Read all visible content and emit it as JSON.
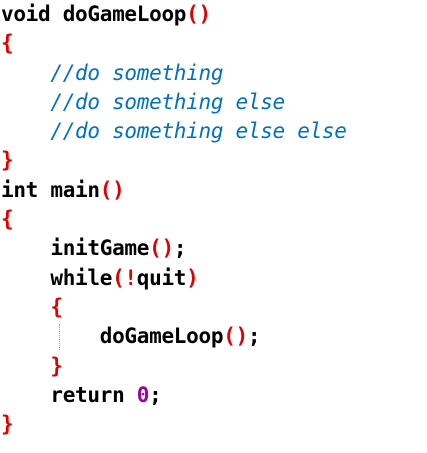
{
  "editor": {
    "lines": [
      [
        {
          "t": "void",
          "c": "kw"
        },
        {
          "t": " doGameLoop",
          "c": "ident"
        },
        {
          "t": "()",
          "c": "punct"
        }
      ],
      [
        {
          "t": "{",
          "c": "punct"
        }
      ],
      [
        {
          "t": "    ",
          "c": "ws"
        },
        {
          "t": "//do something",
          "c": "comment"
        }
      ],
      [
        {
          "t": "    ",
          "c": "ws"
        },
        {
          "t": "//do something else",
          "c": "comment"
        }
      ],
      [
        {
          "t": "    ",
          "c": "ws"
        },
        {
          "t": "//do something else else",
          "c": "comment"
        }
      ],
      [
        {
          "t": "}",
          "c": "punct"
        }
      ],
      [
        {
          "t": "int",
          "c": "kw"
        },
        {
          "t": " main",
          "c": "ident"
        },
        {
          "t": "()",
          "c": "punct"
        }
      ],
      [
        {
          "t": "{",
          "c": "punct"
        }
      ],
      [
        {
          "t": "    ",
          "c": "ws"
        },
        {
          "t": "initGame",
          "c": "ident"
        },
        {
          "t": "()",
          "c": "punct"
        },
        {
          "t": ";",
          "c": "ident"
        }
      ],
      [
        {
          "t": "    ",
          "c": "ws"
        },
        {
          "t": "while",
          "c": "kw"
        },
        {
          "t": "(!",
          "c": "punct"
        },
        {
          "t": "quit",
          "c": "ident"
        },
        {
          "t": ")",
          "c": "punct"
        }
      ],
      [
        {
          "t": "    ",
          "c": "ws"
        },
        {
          "t": "{",
          "c": "punct"
        }
      ],
      [
        {
          "t": "        ",
          "c": "ws"
        },
        {
          "t": "doGameLoop",
          "c": "ident"
        },
        {
          "t": "()",
          "c": "punct"
        },
        {
          "t": ";",
          "c": "ident"
        }
      ],
      [
        {
          "t": "    ",
          "c": "ws"
        },
        {
          "t": "}",
          "c": "punct"
        }
      ],
      [
        {
          "t": "    ",
          "c": "ws"
        },
        {
          "t": "return",
          "c": "kw"
        },
        {
          "t": " ",
          "c": "ws"
        },
        {
          "t": "0",
          "c": "number"
        },
        {
          "t": ";",
          "c": "ident"
        }
      ],
      [
        {
          "t": "}",
          "c": "punct"
        }
      ]
    ],
    "colors": {
      "keyword": "#000000",
      "identifier": "#000000",
      "punctuation": "#e00000",
      "comment": "#0070c0",
      "number": "#a000a0"
    }
  }
}
